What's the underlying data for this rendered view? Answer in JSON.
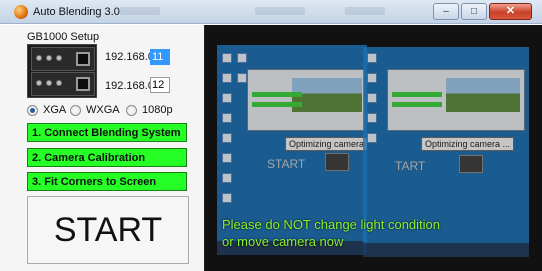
{
  "window": {
    "title": "Auto Blending 3.0",
    "minimize_icon": "minimize-icon",
    "maximize_icon": "maximize-icon",
    "close_icon": "close-icon"
  },
  "setup": {
    "title": "GB1000 Setup",
    "ip_rows": [
      {
        "prefix": "192.168.0.",
        "value": "11",
        "selected": true
      },
      {
        "prefix": "192.168.0.",
        "value": "12",
        "selected": false
      }
    ]
  },
  "resolution": {
    "options": [
      {
        "label": "XGA",
        "checked": true
      },
      {
        "label": "WXGA",
        "checked": false
      },
      {
        "label": "1080p",
        "checked": false
      }
    ]
  },
  "steps": [
    {
      "label": "1. Connect Blending System"
    },
    {
      "label": "2. Camera Calibration"
    },
    {
      "label": "3. Fit Corners to Screen"
    }
  ],
  "start_label": "START",
  "camera": {
    "optimizing_left": "Optimizing camera ...",
    "optimizing_right": "Optimizing camera ...",
    "ghost_start_left": "START",
    "ghost_start_right": "TART",
    "warning_line1": "Please do NOT change light condition",
    "warning_line2": "or move camera now"
  },
  "colors": {
    "step_button_bg": "#25ff25",
    "warning_text": "#8cf02a",
    "selected_input_bg": "#3399ff",
    "close_button": "#c9412a"
  }
}
